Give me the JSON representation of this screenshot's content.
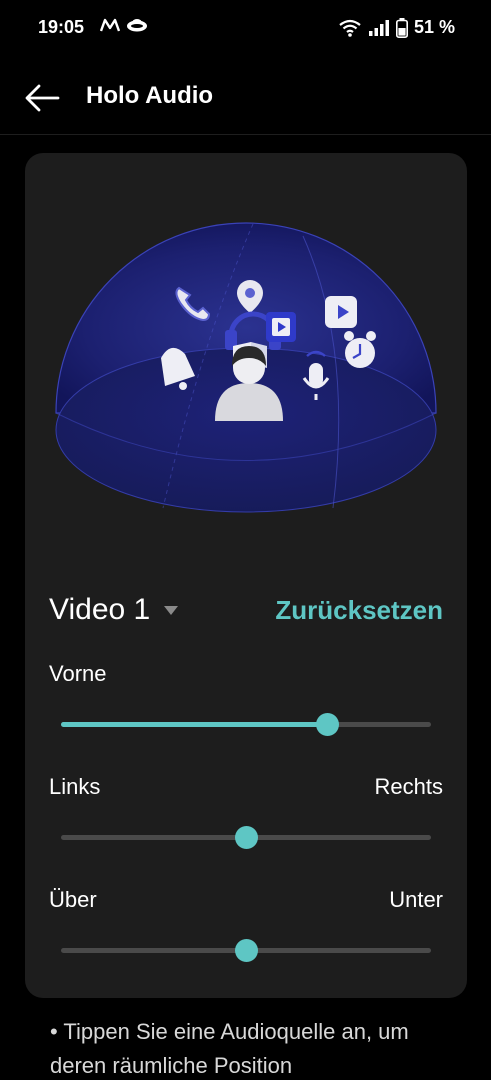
{
  "status_bar": {
    "time": "19:05",
    "battery": "51 %",
    "icons": [
      "m-notification-icon",
      "cloud-icon",
      "wifi-icon",
      "signal-icon",
      "battery-icon"
    ]
  },
  "app_bar": {
    "title": "Holo Audio",
    "back_icon": "arrow-left-icon"
  },
  "preset": {
    "label": "Video 1",
    "reset": "Zurücksetzen"
  },
  "sliders": [
    {
      "left_label": "Vorne",
      "right_label": "",
      "value": 0.72
    },
    {
      "left_label": "Links",
      "right_label": "Rechts",
      "value": 0.5
    },
    {
      "left_label": "Über",
      "right_label": "Unter",
      "value": 0.5
    }
  ],
  "hint": {
    "text": "• Tippen Sie eine Audioquelle an, um deren räumliche Position"
  },
  "colors": {
    "accent": "#5ec6c4",
    "background": "#000000",
    "card": "#1d1d1d",
    "track": "#4a4a4a"
  }
}
